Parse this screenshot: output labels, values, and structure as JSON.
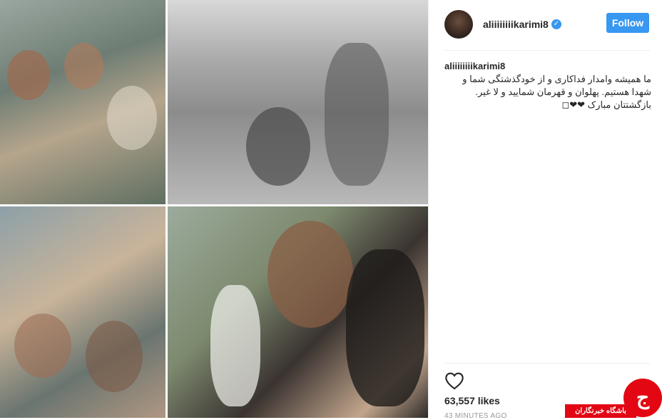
{
  "post": {
    "photos": [
      {
        "name": "photo-bus-soldiers"
      },
      {
        "name": "photo-kneeling-man"
      },
      {
        "name": "photo-crowd-bus"
      },
      {
        "name": "photo-crying-soldier"
      }
    ]
  },
  "header": {
    "username": "aliiiiiiiikarimi8",
    "verified_glyph": "✓",
    "follow_label": "Follow"
  },
  "caption": {
    "username": "aliiiiiiiikarimi8",
    "text": "ما همیشه وامدار فداکاری و از خودگذشتگی شما و شهدا هستیم. پهلوان و قهرمان شمایید و لا غیر. بازگشتتان مبارک ❤❤◻"
  },
  "actions": {
    "heart_icon": "heart-outline-icon"
  },
  "likes": "63,557 likes",
  "timestamp": "43 MINUTES AGO",
  "watermark": {
    "label": "باشگاه خبرنگاران",
    "glyph": "ج"
  },
  "colors": {
    "follow_button": "#3897f0",
    "watermark_red": "#e30613"
  }
}
